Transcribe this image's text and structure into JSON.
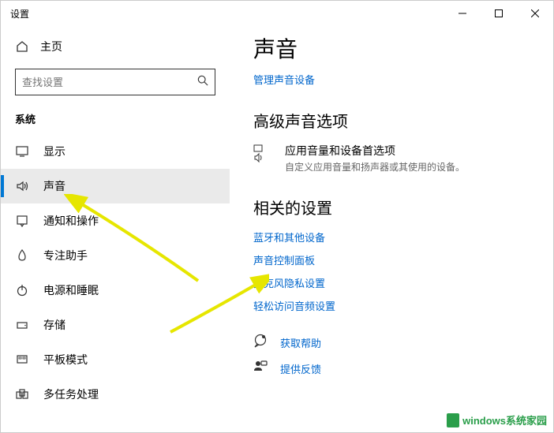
{
  "window": {
    "title": "设置"
  },
  "sidebar": {
    "home": "主页",
    "search_placeholder": "查找设置",
    "category": "系统",
    "items": [
      {
        "label": "显示"
      },
      {
        "label": "声音"
      },
      {
        "label": "通知和操作"
      },
      {
        "label": "专注助手"
      },
      {
        "label": "电源和睡眠"
      },
      {
        "label": "存储"
      },
      {
        "label": "平板模式"
      },
      {
        "label": "多任务处理"
      }
    ]
  },
  "main": {
    "title": "声音",
    "manage_link": "管理声音设备",
    "advanced_header": "高级声音选项",
    "app_volume_title": "应用音量和设备首选项",
    "app_volume_desc": "自定义应用音量和扬声器或其使用的设备。",
    "related_header": "相关的设置",
    "related_links": [
      "蓝牙和其他设备",
      "声音控制面板",
      "麦克风隐私设置",
      "轻松访问音频设置"
    ],
    "help": "获取帮助",
    "feedback": "提供反馈"
  },
  "watermark": "windows系统家园"
}
